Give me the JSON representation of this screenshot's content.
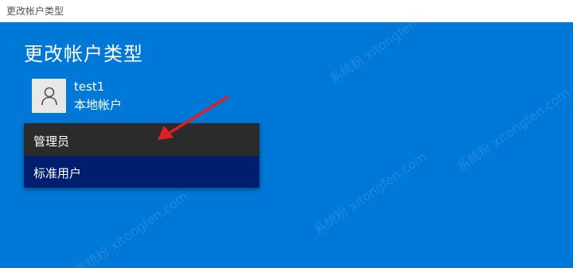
{
  "window": {
    "title": "更改帐户类型",
    "background_color": "#0078d7"
  },
  "page": {
    "heading": "更改帐户类型"
  },
  "account": {
    "name": "test1",
    "type": "本地帐户",
    "avatar_icon": "person-icon"
  },
  "dropdown": {
    "options": [
      {
        "label": "管理员",
        "selected": false
      },
      {
        "label": "标准用户",
        "selected": true
      }
    ],
    "highlight_color": "#001e6e"
  },
  "annotation": {
    "arrow_color": "#e02020"
  },
  "watermark": {
    "text": "系统粉 xitongfen.com"
  }
}
